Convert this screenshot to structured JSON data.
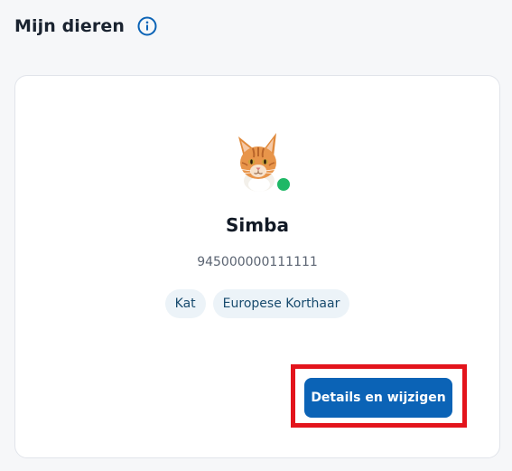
{
  "header": {
    "title": "Mijn dieren",
    "info_icon": "info-icon"
  },
  "pet": {
    "name": "Simba",
    "chip_number": "945000000111111",
    "avatar_icon": "cat-avatar",
    "status_color": "#1fb866",
    "tags": [
      "Kat",
      "Europese Korthaar"
    ]
  },
  "actions": {
    "details_label": "Details en wijzigen"
  },
  "colors": {
    "accent": "#0b63b6",
    "highlight": "#e3141c",
    "tag_bg": "#ecf3f8"
  }
}
